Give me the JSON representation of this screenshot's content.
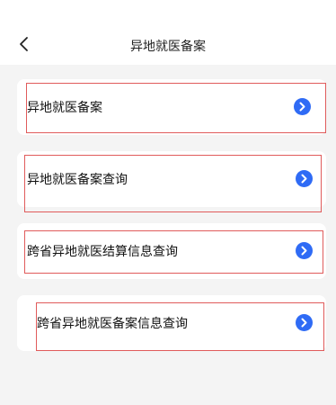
{
  "header": {
    "title": "异地就医备案"
  },
  "menu": {
    "items": [
      {
        "label": "异地就医备案"
      },
      {
        "label": "异地就医备案查询"
      },
      {
        "label": "跨省异地就医结算信息查询"
      },
      {
        "label": "跨省异地就医备案信息查询"
      }
    ]
  },
  "icons": {
    "back": "chevron-left-icon",
    "arrow": "chevron-right-circle-icon"
  },
  "colors": {
    "accent": "#2f6bf5",
    "highlight": "#e05b5b",
    "background": "#f4f4f4"
  }
}
